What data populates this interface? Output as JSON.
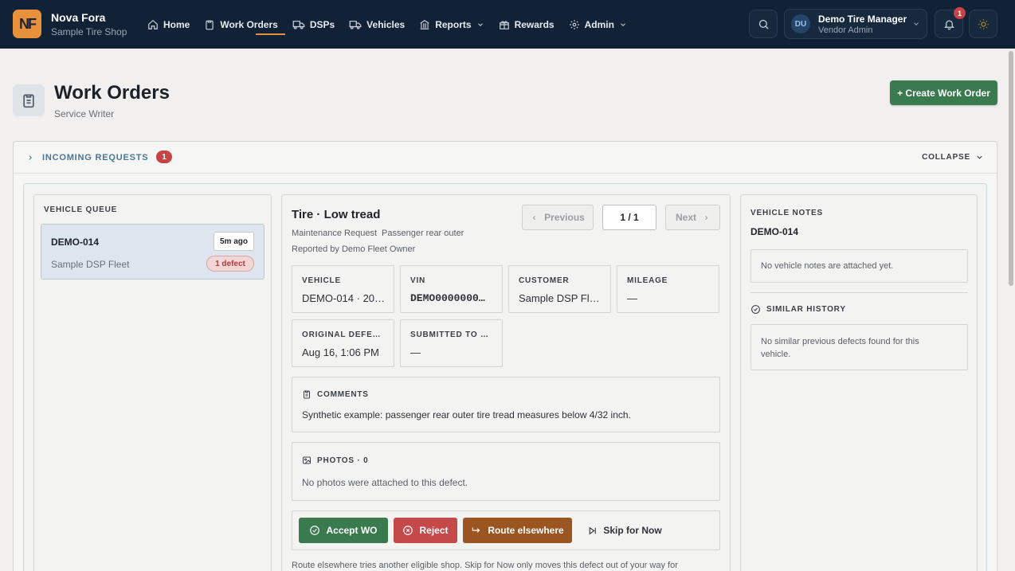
{
  "brand": {
    "logo_text": "NF",
    "name": "Nova Fora",
    "shop": "Sample Tire Shop"
  },
  "nav": {
    "items": [
      {
        "label": "Home",
        "icon": "home-icon"
      },
      {
        "label": "Work Orders",
        "icon": "clipboard-icon"
      },
      {
        "label": "DSPs",
        "icon": "truck-icon"
      },
      {
        "label": "Vehicles",
        "icon": "truck-icon"
      },
      {
        "label": "Reports",
        "icon": "bank-icon"
      },
      {
        "label": "Rewards",
        "icon": "gift-icon"
      },
      {
        "label": "Admin",
        "icon": "gear-icon"
      }
    ],
    "active": "Work Orders"
  },
  "user": {
    "initials": "DU",
    "name": "Demo Tire Manager",
    "role": "Vendor Admin"
  },
  "notifications": {
    "count": "1"
  },
  "page": {
    "title": "Work Orders",
    "subtitle": "Service Writer",
    "create_label": "+ Create Work Order"
  },
  "requests": {
    "label": "INCOMING REQUESTS",
    "count": "1",
    "collapse_label": "COLLAPSE"
  },
  "queue": {
    "label": "VEHICLE QUEUE",
    "items": [
      {
        "id": "DEMO-014",
        "fleet": "Sample DSP Fleet",
        "age": "5m ago",
        "defects": "1 defect"
      }
    ]
  },
  "detail": {
    "title": "Tire · Low tread",
    "type": "Maintenance Request",
    "position": "Passenger rear outer",
    "reported_by": "Reported by Demo Fleet Owner",
    "pager": {
      "previous": "Previous",
      "position": "1 / 1",
      "next": "Next"
    },
    "fields": [
      {
        "label": "VEHICLE",
        "value": "DEMO-014 · 20…"
      },
      {
        "label": "VIN",
        "value": "DEMO0000000…"
      },
      {
        "label": "CUSTOMER",
        "value": "Sample DSP Fle…"
      },
      {
        "label": "MILEAGE",
        "value": "—"
      },
      {
        "label": "ORIGINAL DEFE…",
        "value": "Aug 16, 1:06 PM"
      },
      {
        "label": "SUBMITTED TO …",
        "value": "—"
      }
    ],
    "comments": {
      "label": "COMMENTS",
      "text": "Synthetic example: passenger rear outer tire tread measures below 4/32 inch."
    },
    "photos": {
      "label": "PHOTOS · 0",
      "text": "No photos were attached to this defect."
    },
    "actions": {
      "accept": "Accept WO",
      "reject": "Reject",
      "route": "Route elsewhere",
      "skip": "Skip for Now"
    },
    "footnote": "Route elsewhere tries another eligible shop. Skip for Now only moves this defect out of your way for"
  },
  "notes": {
    "label": "VEHICLE NOTES",
    "vehicle": "DEMO-014",
    "empty": "No vehicle notes are attached yet.",
    "history_label": "SIMILAR HISTORY",
    "history_empty": "No similar previous defects found for this vehicle."
  },
  "colors": {
    "navbar": "#122236",
    "accent": "#e8913c",
    "accept": "#3a7a4f",
    "reject": "#c44a4a",
    "route": "#9a5520"
  }
}
